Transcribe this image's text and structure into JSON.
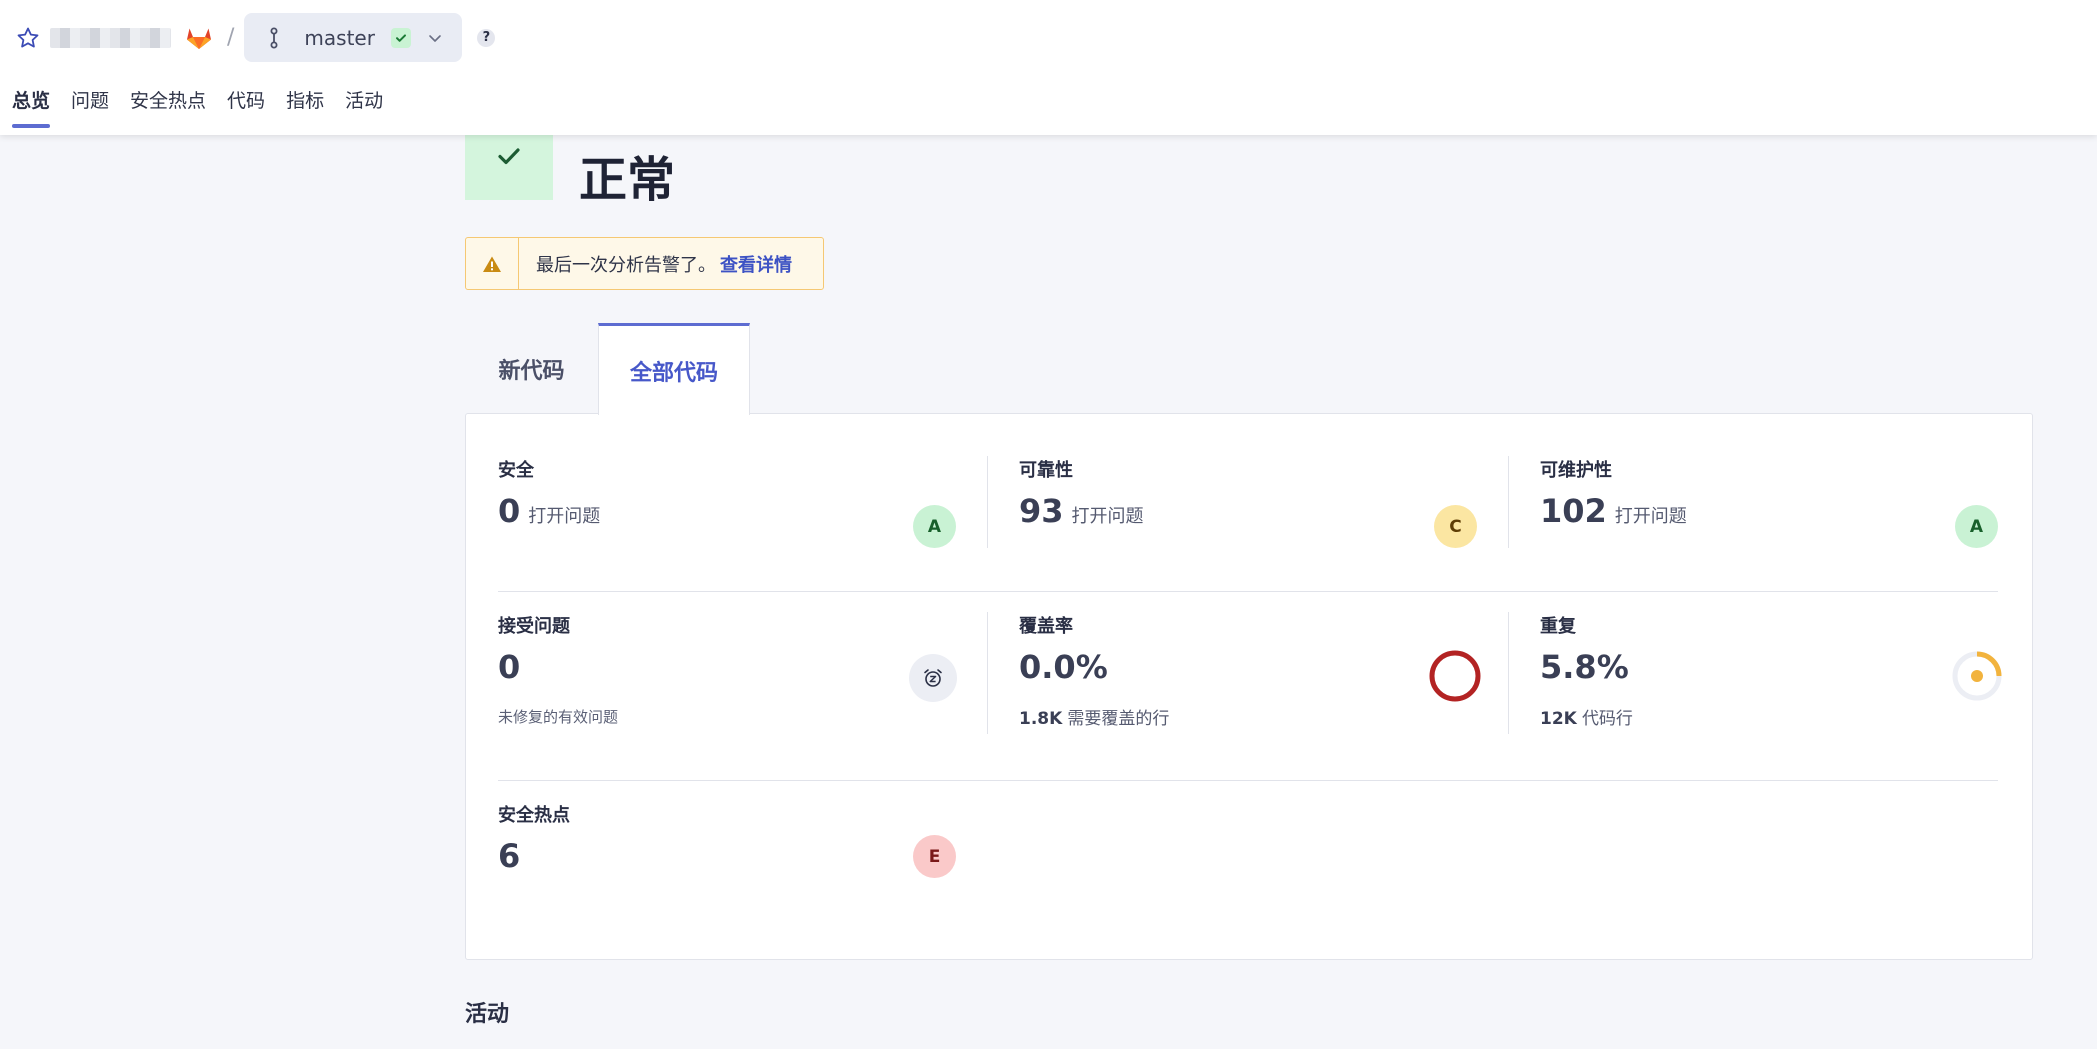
{
  "header": {
    "project_name": "",
    "separator": "/",
    "branch": "master",
    "help": "?"
  },
  "nav": {
    "items": [
      {
        "label": "总览",
        "active": true
      },
      {
        "label": "问题"
      },
      {
        "label": "安全热点"
      },
      {
        "label": "代码"
      },
      {
        "label": "指标"
      },
      {
        "label": "活动"
      }
    ]
  },
  "quality_gate": {
    "status": "正常",
    "status_color": "#d4f5dd"
  },
  "warning": {
    "text": "最后一次分析告警了。",
    "link": "查看详情"
  },
  "tabs": {
    "new_code": "新代码",
    "overall_code": "全部代码",
    "active": "overall_code"
  },
  "metrics": {
    "security": {
      "title": "安全",
      "value": "0",
      "unit": "打开问题",
      "grade": "A"
    },
    "reliability": {
      "title": "可靠性",
      "value": "93",
      "unit": "打开问题",
      "grade": "C"
    },
    "maintainability": {
      "title": "可维护性",
      "value": "102",
      "unit": "打开问题",
      "grade": "A"
    },
    "accepted_issues": {
      "title": "接受问题",
      "value": "0",
      "note": "未修复的有效问题",
      "icon": "alarm-clock-icon"
    },
    "coverage": {
      "title": "覆盖率",
      "value": "0.0%",
      "sub_num": "1.8K",
      "sub_text": "需要覆盖的行",
      "percent": 0
    },
    "duplications": {
      "title": "重复",
      "value": "5.8%",
      "sub_num": "12K",
      "sub_text": "代码行",
      "percent": 5.8
    },
    "hotspots": {
      "title": "安全热点",
      "value": "6",
      "grade": "E"
    }
  },
  "activity": {
    "title": "活动"
  },
  "colors": {
    "accent": "#5d6cd1",
    "grade_a": "#c9f2d4",
    "grade_c": "#fbe6a2",
    "grade_e": "#fac9c9",
    "coverage_ring": "#b32323",
    "duplication_ring": "#f2b33d"
  }
}
